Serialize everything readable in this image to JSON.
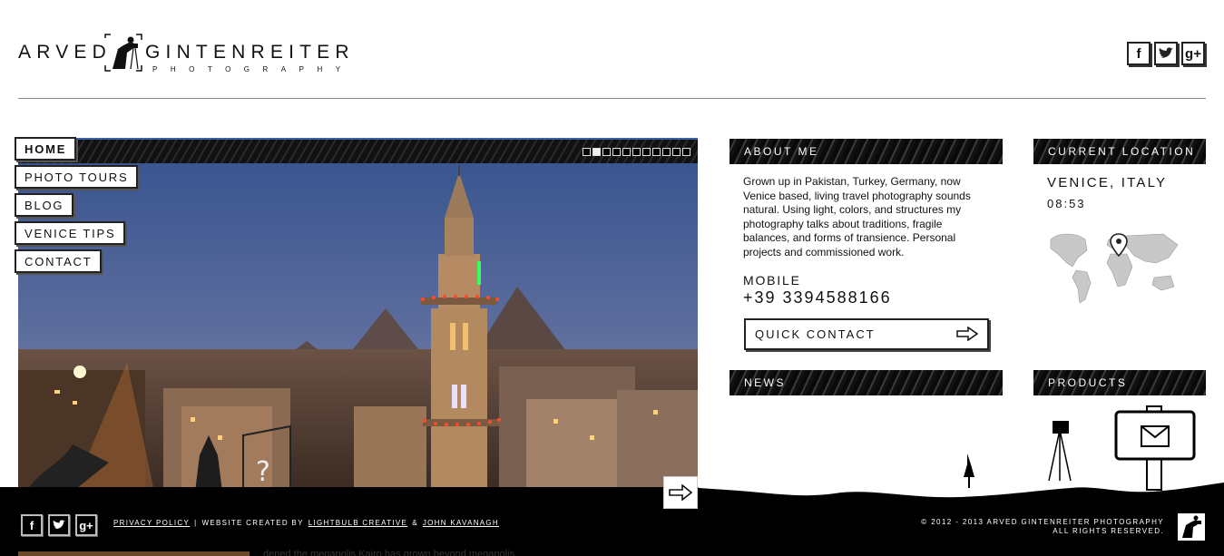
{
  "header": {
    "logo_first": "ARVED",
    "logo_second": "GINTENREITER",
    "logo_sub": "PHOTOGRAPHY",
    "social": [
      "f",
      "t",
      "g+"
    ]
  },
  "nav": {
    "items": [
      {
        "label": "HOME",
        "active": true
      },
      {
        "label": "PHOTO TOURS"
      },
      {
        "label": "BLOG"
      },
      {
        "label": "VENICE TIPS"
      },
      {
        "label": "CONTACT"
      }
    ]
  },
  "slider": {
    "slide_count": 11,
    "active_index": 1
  },
  "about": {
    "heading": "ABOUT ME",
    "text": "Grown up in Pakistan, Turkey, Germany, now Venice based, living travel photography sounds natural. Using light, colors, and structures my photography talks about traditions, fragile balances, and forms of transience. Personal projects and commissioned work.",
    "mobile_label": "MOBILE",
    "mobile_number": "+39 3394588166",
    "quick_contact": "QUICK CONTACT"
  },
  "location": {
    "heading": "CURRENT LOCATION",
    "city": "VENICE, ITALY",
    "time": "08:53"
  },
  "news": {
    "heading": "NEWS"
  },
  "products": {
    "heading": "PRODUCTS"
  },
  "footer": {
    "privacy": "PRIVACY POLICY",
    "separator": "|",
    "created_by": "WEBSITE CREATED BY",
    "creator1": "LIGHTBULB CREATIVE",
    "amp": "&",
    "creator2": "JOHN KAVANAGH",
    "copyright": "© 2012 - 2013 ARVED GINTENREITER PHOTOGRAPHY",
    "rights": "ALL RIGHTS RESERVED."
  },
  "below_fold_text": "dened the megapolis Kairo has grown beyond megapolis"
}
